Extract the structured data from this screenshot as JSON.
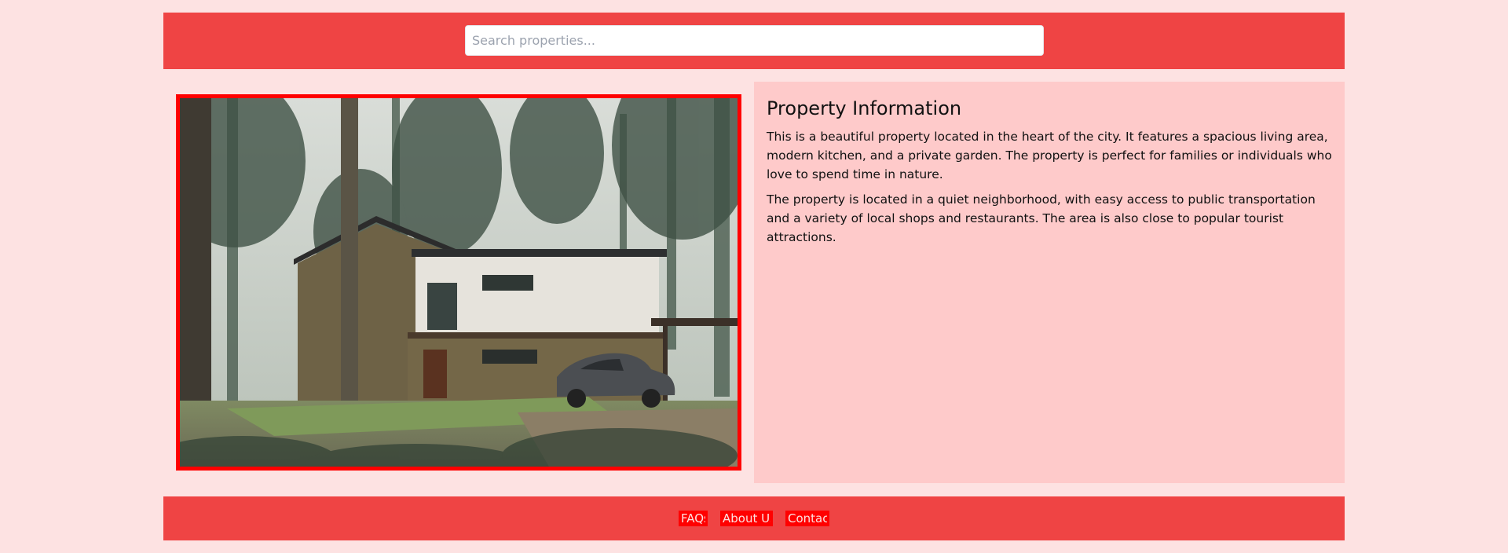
{
  "search": {
    "placeholder": "Search properties..."
  },
  "main": {
    "image_alt": "Stone and white modern house in a pine forest with a grey car parked in front",
    "info": {
      "title": "Property Information",
      "paragraphs": [
        "This is a beautiful property located in the heart of the city. It features a spacious living area, modern kitchen, and a private garden. The property is perfect for families or individuals who love to spend time in nature.",
        "The property is located in a quiet neighborhood, with easy access to public transportation and a variety of local shops and restaurants. The area is also close to popular tourist attractions."
      ]
    }
  },
  "footer": {
    "links": [
      {
        "label": "FAQs"
      },
      {
        "label": "About Us"
      },
      {
        "label": "Contact"
      }
    ]
  },
  "colors": {
    "page_bg": "#fde2e2",
    "header_bg": "#ef4444",
    "info_bg": "#fecaca",
    "accent_border": "#ff0000"
  }
}
